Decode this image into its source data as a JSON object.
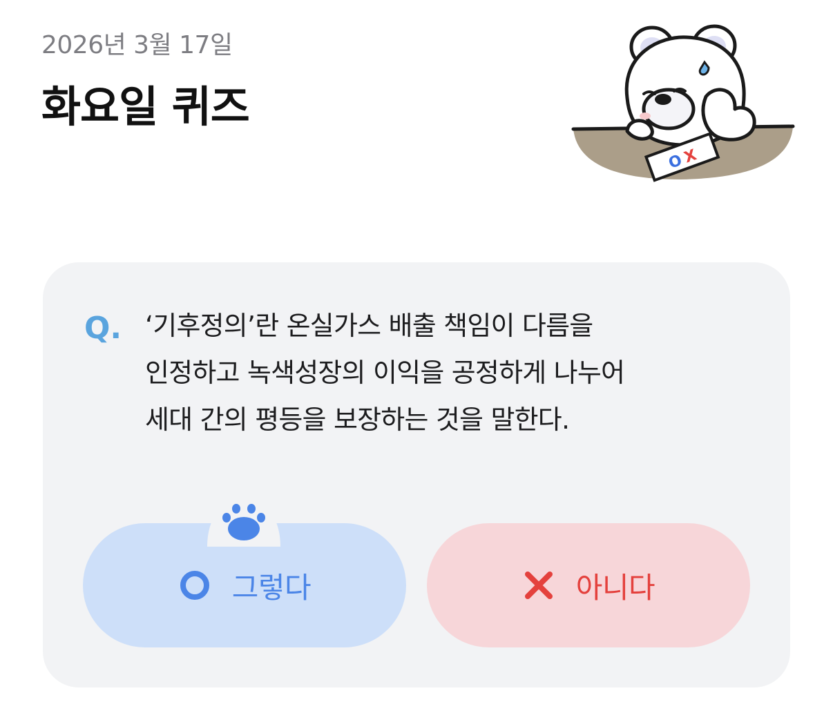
{
  "header": {
    "date": "2026년 3월 17일",
    "title": "화요일 퀴즈"
  },
  "quiz": {
    "q_prefix": "Q.",
    "question_lines": [
      "‘기후정의’란 온실가스 배출 책임이 다름을",
      "인정하고 녹색성장의 이익을 공정하게 나누어",
      "세대 간의 평등을 보장하는 것을 말한다."
    ],
    "answers": {
      "yes_label": "그렇다",
      "no_label": "아니다"
    },
    "mascot_paper": {
      "o": "O",
      "x": "X"
    }
  },
  "colors": {
    "card_bg": "#f2f3f5",
    "yes_bg": "#cddff9",
    "yes_fg": "#4b85e7",
    "no_bg": "#f7d6d9",
    "no_fg": "#e4413d",
    "q_color": "#5aa4de"
  },
  "icons": {
    "yes": "circle-o-icon",
    "no": "x-mark-icon",
    "paw": "paw-icon",
    "mascot": "polar-bear-mascot"
  }
}
